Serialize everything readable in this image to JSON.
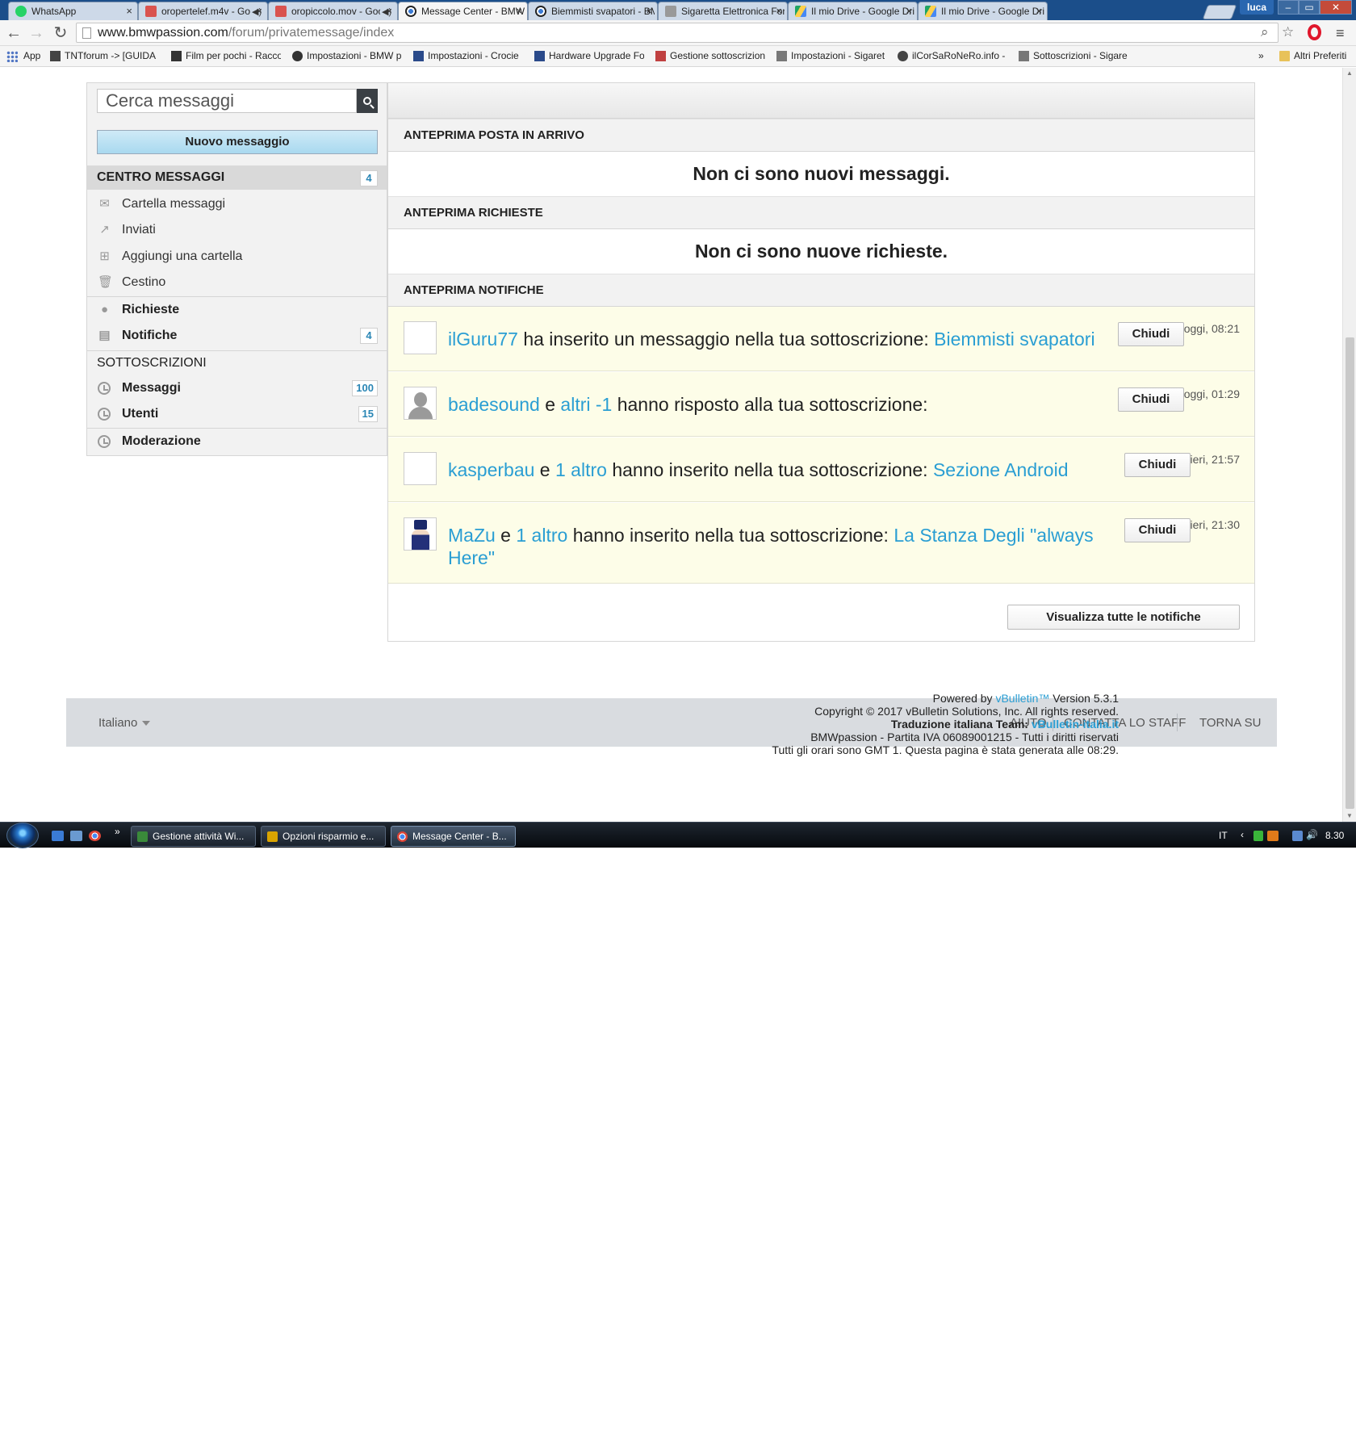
{
  "browser": {
    "tabs": [
      {
        "label": "WhatsApp",
        "color": "#25d366",
        "audio": false
      },
      {
        "label": "oropertelef.m4v - Goo",
        "color": "#d9534f",
        "audio": true
      },
      {
        "label": "oropiccolo.mov - Goo",
        "color": "#d9534f",
        "audio": true
      },
      {
        "label": "Message Center - BMWp",
        "color": "#555555",
        "audio": false
      },
      {
        "label": "Biemmisti svapatori - BM",
        "color": "#555555",
        "audio": false
      },
      {
        "label": "Sigaretta Elettronica For",
        "color": "#888888",
        "audio": false
      },
      {
        "label": "Il mio Drive - Google Dri",
        "color": "#1fa463",
        "audio": false
      },
      {
        "label": "Il mio Drive - Google Dri",
        "color": "#1fa463",
        "audio": false
      }
    ],
    "user": "luca",
    "window_buttons": [
      "–",
      "▭",
      "✕"
    ],
    "url_host": "www.bmwpassion.com",
    "url_path": "/forum/privatemessage/index",
    "bookmarks": [
      {
        "label": "App"
      },
      {
        "label": "TNTforum -> [GUIDA",
        "color": "#444444"
      },
      {
        "label": "Film per pochi - Racco",
        "color": "#333333"
      },
      {
        "label": "Impostazioni - BMW p",
        "color": "#333333"
      },
      {
        "label": "Impostazioni - Crocie",
        "color": "#2a4a8a"
      },
      {
        "label": "Hardware Upgrade Fo",
        "color": "#2a4a8a"
      },
      {
        "label": "Gestione sottoscrizioni",
        "color": "#c04040"
      },
      {
        "label": "Impostazioni - Sigaret",
        "color": "#777777"
      },
      {
        "label": "ilCorSaRoNeRo.info -",
        "color": "#444444"
      },
      {
        "label": "Sottoscrizioni - Sigare",
        "color": "#777777"
      }
    ],
    "other_bookmarks": "Altri Preferiti"
  },
  "sidebar": {
    "search_placeholder": "Cerca messaggi",
    "new_message": "Nuovo messaggio",
    "messages_header": "CENTRO MESSAGGI",
    "messages_count": "4",
    "folders": [
      {
        "label": "Cartella messaggi"
      },
      {
        "label": "Inviati"
      },
      {
        "label": "Aggiungi una cartella"
      },
      {
        "label": "Cestino"
      }
    ],
    "requests": "Richieste",
    "notifications": "Notifiche",
    "notifications_count": "4",
    "subscriptions_header": "SOTTOSCRIZIONI",
    "subs": [
      {
        "label": "Messaggi",
        "count": "100"
      },
      {
        "label": "Utenti",
        "count": "15"
      }
    ],
    "moderation": "Moderazione"
  },
  "main": {
    "inbox_header": "ANTEPRIMA POSTA IN ARRIVO",
    "inbox_empty": "Non ci sono nuovi messaggi.",
    "requests_header": "ANTEPRIMA RICHIESTE",
    "requests_empty": "Non ci sono nuove richieste.",
    "notifications_header": "ANTEPRIMA NOTIFICHE",
    "notifications": [
      {
        "user": "ilGuru77",
        "middle": "",
        "others": "",
        "action": " ha inserito un messaggio nella tua sottoscrizione: ",
        "topic": "Biemmisti svapatori",
        "close": "Chiudi",
        "time": "oggi, 08:21"
      },
      {
        "user": "badesound",
        "middle": " e ",
        "others": "altri -1",
        "action": " hanno risposto alla tua sottoscrizione:",
        "topic": "",
        "close": "Chiudi",
        "time": "oggi, 01:29"
      },
      {
        "user": "kasperbau",
        "middle": " e ",
        "others": "1 altro",
        "action": " hanno inserito nella tua sottoscrizione: ",
        "topic": "Sezione Android",
        "close": "Chiudi",
        "time": "ieri, 21:57"
      },
      {
        "user": "MaZu",
        "middle": " e ",
        "others": "1 altro",
        "action": " hanno inserito nella tua sottoscrizione: ",
        "topic": "La Stanza Degli \"always Here\"",
        "close": "Chiudi",
        "time": "ieri, 21:30"
      }
    ],
    "view_all": "Visualizza tutte le notifiche"
  },
  "footer": {
    "language": "Italiano",
    "links": [
      "AIUTO",
      "CONTATTA LO STAFF",
      "TORNA SU"
    ],
    "powered_prefix": "Powered by ",
    "powered_link": "vBulletin™",
    "powered_version": " Version 5.3.1",
    "copyright": "Copyright © 2017 vBulletin Solutions, Inc. All rights reserved.",
    "translation_prefix": "Traduzione italiana Team: ",
    "translation_link": "vBulletin-italia.it",
    "company": "BMWpassion - Partita IVA 06089001215 - Tutti i diritti riservati",
    "timezone": "Tutti gli orari sono GMT 1. Questa pagina è stata generata alle 08:29."
  },
  "taskbar": {
    "tasks": [
      {
        "label": "Gestione attività Wi...",
        "color": "#3a8a3a"
      },
      {
        "label": "Opzioni risparmio e...",
        "color": "#d9a400"
      },
      {
        "label": "Message Center - B...",
        "color": "#db4437"
      }
    ],
    "language": "IT",
    "time": "8.30"
  },
  "colors": {
    "link": "#2a9ed3",
    "notification_bg": "#fdfde8",
    "accent_button": "#a9d9ef"
  }
}
